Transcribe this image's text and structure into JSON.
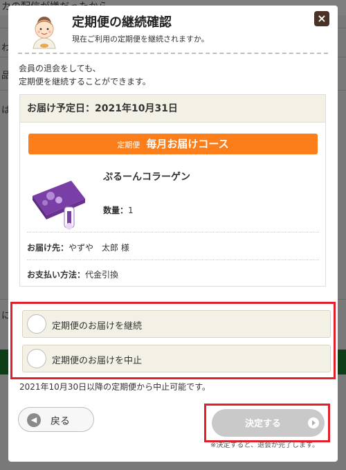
{
  "background": {
    "top_text": "カの配信が嫌だったから",
    "fragments": [
      "わ",
      "品",
      "は",
      "に"
    ]
  },
  "modal": {
    "title": "定期便の継続確認",
    "subtitle": "現在ご利用の定期便を継続されますか。",
    "close_label": "×",
    "intro_line1": "会員の退会をしても、",
    "intro_line2": "定期便を継続することができます。",
    "card": {
      "delivery_date": "お届け予定日：2021年10月31日",
      "course_small": "定期便",
      "course_big": "毎月お届けコース",
      "product_name": "ぷるーんコラーゲン",
      "qty_label": "数量：",
      "qty_value": "1",
      "dest_label": "お届け先：",
      "dest_value": "やずや　太郎 様",
      "pay_label": "お支払い方法：",
      "pay_value": "代金引換"
    },
    "options": [
      {
        "label": "定期便のお届けを継続"
      },
      {
        "label": "定期便のお届けを中止"
      }
    ],
    "note": "2021年10月30日以降の定期便から中止可能です。",
    "back_label": "戻る",
    "confirm_label": "決定する",
    "confirm_note": "※決定すると、退会が完了します。"
  },
  "colors": {
    "accent_orange": "#fb7e1b",
    "highlight_red": "#e0202b",
    "close_brown": "#4a3226"
  }
}
